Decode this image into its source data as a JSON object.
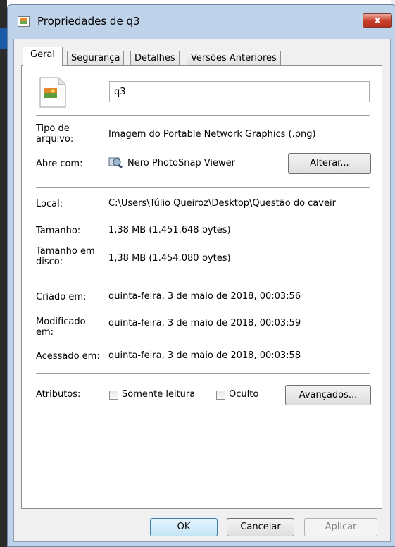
{
  "window": {
    "title": "Propriedades de q3",
    "close_label": "x"
  },
  "tabs": [
    {
      "label": "Geral",
      "active": true
    },
    {
      "label": "Segurança",
      "active": false
    },
    {
      "label": "Detalhes",
      "active": false
    },
    {
      "label": "Versões Anteriores",
      "active": false
    }
  ],
  "general": {
    "file_name": "q3",
    "file_type": {
      "label": "Tipo de arquivo:",
      "value": "Imagem do Portable Network Graphics (.png)"
    },
    "opens_with": {
      "label": "Abre com:",
      "value": "Nero PhotoSnap Viewer",
      "change_button": "Alterar..."
    },
    "location": {
      "label": "Local:",
      "value": "C:\\Users\\Túlio Queiroz\\Desktop\\Questão do caveir"
    },
    "size": {
      "label": "Tamanho:",
      "value": "1,38 MB (1.451.648 bytes)"
    },
    "size_on_disk": {
      "label": "Tamanho em disco:",
      "value": "1,38 MB (1.454.080 bytes)"
    },
    "created": {
      "label": "Criado em:",
      "value": "quinta-feira, 3 de maio de 2018, 00:03:56"
    },
    "modified": {
      "label": "Modificado em:",
      "value": "quinta-feira, 3 de maio de 2018, 00:03:59"
    },
    "accessed": {
      "label": "Acessado em:",
      "value": "quinta-feira, 3 de maio de 2018, 00:03:58"
    },
    "attributes": {
      "label": "Atributos:",
      "read_only": {
        "label": "Somente leitura",
        "checked": false
      },
      "hidden": {
        "label": "Oculto",
        "checked": false
      },
      "advanced_button": "Avançados..."
    }
  },
  "footer": {
    "ok": "OK",
    "cancel": "Cancelar",
    "apply": "Aplicar"
  },
  "colors": {
    "frame": "#bed3ea",
    "close": "#c8402b",
    "client": "#f0f0f0"
  }
}
